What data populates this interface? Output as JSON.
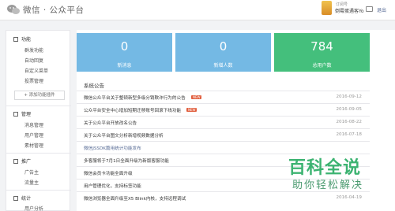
{
  "header": {
    "brand": "微信 · 公众平台",
    "user_top": "订阅号",
    "user_name": "倒霉蛋遇客Yo",
    "logout": "退出"
  },
  "sidebar": {
    "groups": [
      {
        "label": "功能",
        "items": [
          "群发功能",
          "自动回复",
          "自定义菜单",
          "投票管理"
        ]
      },
      {
        "label": "管理",
        "items": [
          "消息管理",
          "用户管理",
          "素材管理"
        ]
      },
      {
        "label": "推广",
        "items": [
          "广告主",
          "流量主"
        ]
      },
      {
        "label": "统计",
        "items": [
          "用户分析"
        ]
      }
    ],
    "add_plugin": "+ 添加功能插件"
  },
  "stats": {
    "messages": {
      "value": "0",
      "label": "新消息"
    },
    "new_users": {
      "value": "0",
      "label": "新增人数"
    },
    "total_users": {
      "value": "784",
      "label": "总用户数"
    }
  },
  "notices": {
    "title": "系统公告",
    "badge": "NEW",
    "rows": [
      {
        "title": "微信公众平台关于整顿新型多级分销欺诈行为的公告",
        "date": "2016-09-12",
        "new": true,
        "link": false
      },
      {
        "title": "公众平台安全中心增加短期迁移账号回滚下线功能",
        "date": "2016-09-05",
        "new": true,
        "link": false
      },
      {
        "title": "关于公众平台开放改名公告",
        "date": "2016-08-22",
        "new": false,
        "link": false
      },
      {
        "title": "关于公众平台图文分析新增视频数据分析",
        "date": "2016-07-18",
        "new": false,
        "link": false
      },
      {
        "title": "微信JSSDK篇用统计功能发布",
        "date": "",
        "new": false,
        "link": true
      },
      {
        "title": "多客服将于7月1日全面升级为新版客服功能",
        "date": "",
        "new": false,
        "link": false
      },
      {
        "title": "微信会员卡功能全面升级",
        "date": "",
        "new": false,
        "link": false
      },
      {
        "title": "用户管理优化，支持标签功能",
        "date": "",
        "new": false,
        "link": false
      },
      {
        "title": "微信浏览器全面升级至X5 Blink内核，支持远程调试",
        "date": "2016-04-19",
        "new": false,
        "link": false
      }
    ]
  },
  "watermark": {
    "main": "百科全说",
    "sub": "助你轻松解决"
  }
}
